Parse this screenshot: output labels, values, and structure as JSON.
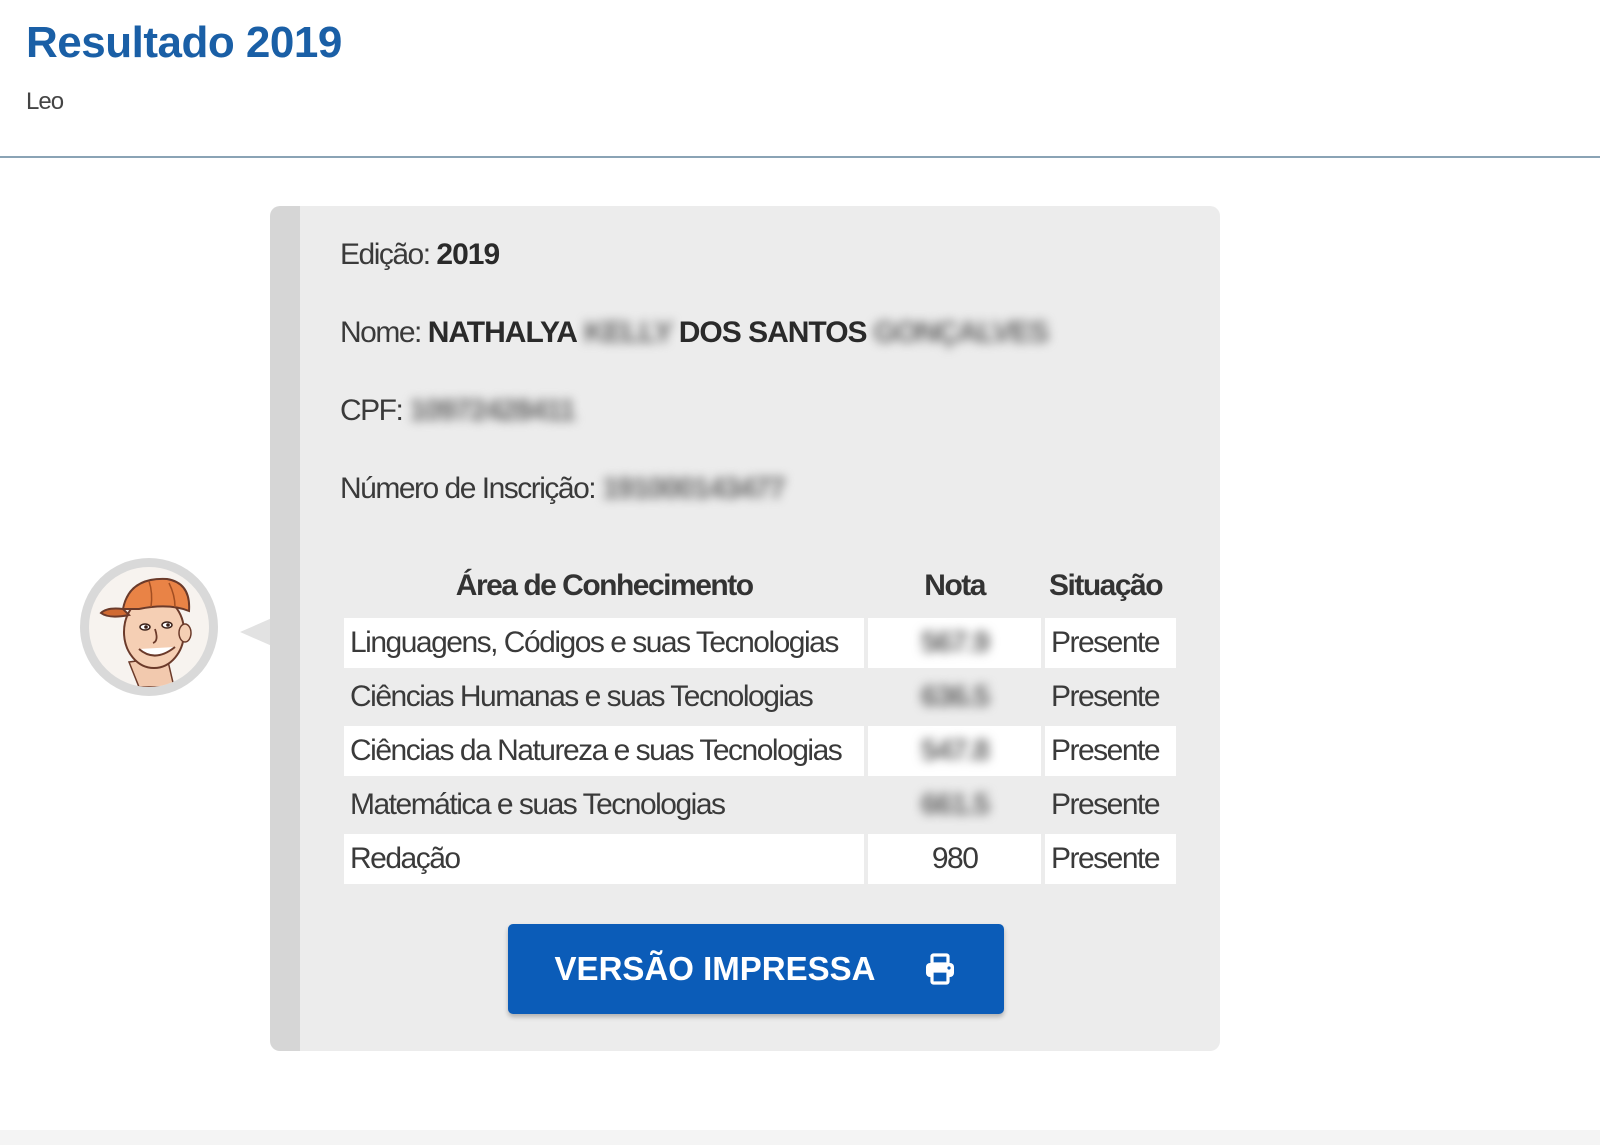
{
  "header": {
    "title": "Resultado 2019",
    "subtitle": "Leo"
  },
  "result": {
    "edicao_label": "Edição:",
    "edicao_value": "2019",
    "nome_label": "Nome:",
    "nome_part1": "NATHALYA",
    "nome_part2_blurred": "KELLY",
    "nome_part3": "DOS SANTOS",
    "nome_part4_blurred": "GONÇALVES",
    "cpf_label": "CPF:",
    "cpf_blurred": "10972428411",
    "inscricao_label": "Número de Inscrição:",
    "inscricao_blurred": "191000143477"
  },
  "table": {
    "headers": {
      "area": "Área de Conhecimento",
      "nota": "Nota",
      "situacao": "Situação"
    },
    "rows": [
      {
        "area": "Linguagens, Códigos e suas Tecnologias",
        "nota": "567.9",
        "situacao": "Presente",
        "nota_blurred": true
      },
      {
        "area": "Ciências Humanas e suas Tecnologias",
        "nota": "636.5",
        "situacao": "Presente",
        "nota_blurred": true
      },
      {
        "area": "Ciências da Natureza e suas Tecnologias",
        "nota": "547.8",
        "situacao": "Presente",
        "nota_blurred": true
      },
      {
        "area": "Matemática e suas Tecnologias",
        "nota": "661.5",
        "situacao": "Presente",
        "nota_blurred": true
      },
      {
        "area": "Redação",
        "nota": "980",
        "situacao": "Presente",
        "nota_blurred": false
      }
    ]
  },
  "actions": {
    "print_label": "VERSÃO IMPRESSA",
    "print_icon": "printer-icon"
  },
  "colors": {
    "title_blue": "#1a5fa6",
    "button_blue": "#0b5cb8",
    "card_bg": "#ececec"
  }
}
